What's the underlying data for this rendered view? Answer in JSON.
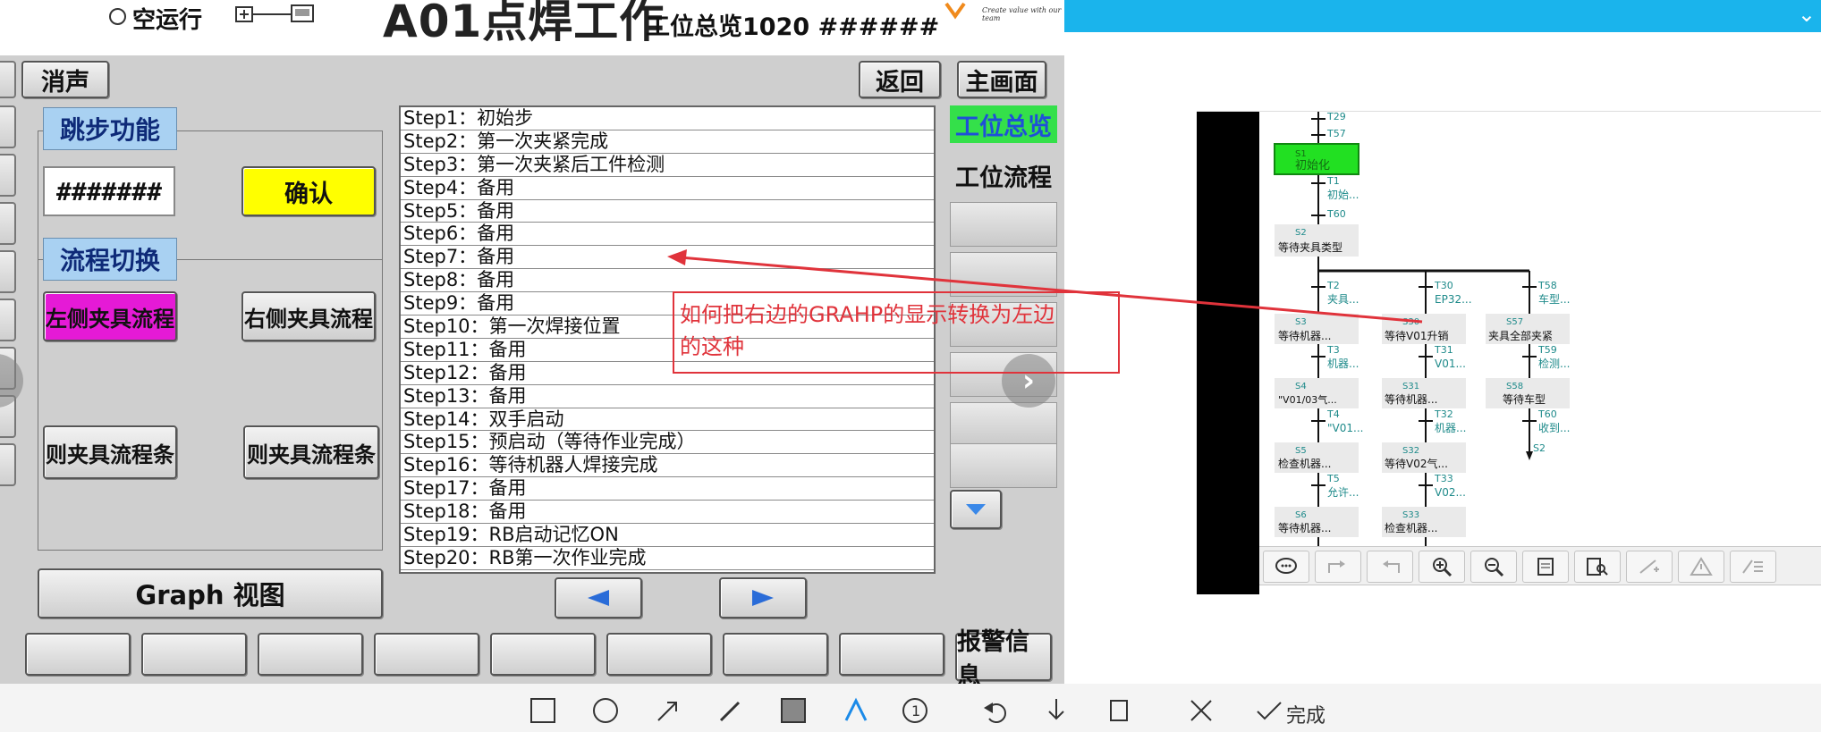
{
  "hmi": {
    "dry_run_label": "空运行",
    "big_title": "A01点焊工作",
    "station_overview": "工位总览1020 ######",
    "slogan": "Create value with our team",
    "mute_button": "消声",
    "back_button": "返回",
    "main_screen_button": "主画面",
    "jump_group_title": "跳步功能",
    "jump_input_value": "#######",
    "confirm_button": "确认",
    "flow_group_title": "流程切换",
    "left_fixture_flow": "左侧夹具流程",
    "right_fixture_flow": "右侧夹具流程",
    "left_fixture_bar": "则夹具流程条",
    "right_fixture_bar": "则夹具流程条",
    "graph_view_button": "Graph 视图",
    "nav_overview": "工位总览",
    "nav_flow": "工位流程",
    "alarm_button": "报警信息",
    "steps": [
      "Step1：初始步",
      "Step2：第一次夹紧完成",
      "Step3：第一次夹紧后工件检测",
      "Step4：备用",
      "Step5：备用",
      "Step6：备用",
      "Step7：备用",
      "Step8：备用",
      "Step9：备用",
      "Step10：第一次焊接位置",
      "Step11：备用",
      "Step12：备用",
      "Step13：备用",
      "Step14：双手启动",
      "Step15：预启动（等待作业完成）",
      "Step16：等待机器人焊接完成",
      "Step17：备用",
      "Step18：备用",
      "Step19：RB启动记忆ON",
      "Step20：RB第一次作业完成"
    ],
    "colors": {
      "confirm": "#ffff00",
      "left_flow": "#e51ad6",
      "group_title": "#a9d1f2",
      "overview_text": "#1f4fd8",
      "overview_bg": "#34e04a"
    }
  },
  "annotation": {
    "text": "如何把右边的GRAHP的显示转换为左边的这种",
    "color": "#e0333b"
  },
  "graph": {
    "top_labels": [
      "T29",
      "T57"
    ],
    "init_step": {
      "id": "S1",
      "label": "初始化",
      "color": "#22e022"
    },
    "t1": {
      "id": "T1",
      "label": "初始..."
    },
    "t60": "T60",
    "s2": {
      "id": "S2",
      "label": "等待夹具类型"
    },
    "branches": [
      {
        "transitions": [
          {
            "id": "T2",
            "label": "夹具..."
          },
          {
            "id": "T3",
            "label": "机器..."
          },
          {
            "id": "T4",
            "label": "\"V01..."
          },
          {
            "id": "T5",
            "label": "允许..."
          }
        ],
        "steps": [
          {
            "id": "S3",
            "label": "等待机器..."
          },
          {
            "id": "S4",
            "label": "\"V01/03气..."
          },
          {
            "id": "S5",
            "label": "检查机器..."
          },
          {
            "id": "S6",
            "label": "等待机器..."
          }
        ]
      },
      {
        "transitions": [
          {
            "id": "T30",
            "label": "EP32..."
          },
          {
            "id": "T31",
            "label": "V01..."
          },
          {
            "id": "T32",
            "label": "机器..."
          },
          {
            "id": "T33",
            "label": "V02..."
          }
        ],
        "steps": [
          {
            "id": "S30",
            "label": "等待V01升销"
          },
          {
            "id": "S31",
            "label": "等待机器..."
          },
          {
            "id": "S32",
            "label": "等待V02气..."
          },
          {
            "id": "S33",
            "label": "检查机器..."
          }
        ]
      },
      {
        "transitions": [
          {
            "id": "T58",
            "label": "车型..."
          },
          {
            "id": "T59",
            "label": "检测..."
          },
          {
            "id": "T60",
            "label": "收到..."
          }
        ],
        "steps": [
          {
            "id": "S57",
            "label": "夹具全部夹紧"
          },
          {
            "id": "S58",
            "label": "等待车型"
          }
        ],
        "jump": "S2"
      }
    ]
  },
  "bottom": {
    "done_label": "完成"
  }
}
